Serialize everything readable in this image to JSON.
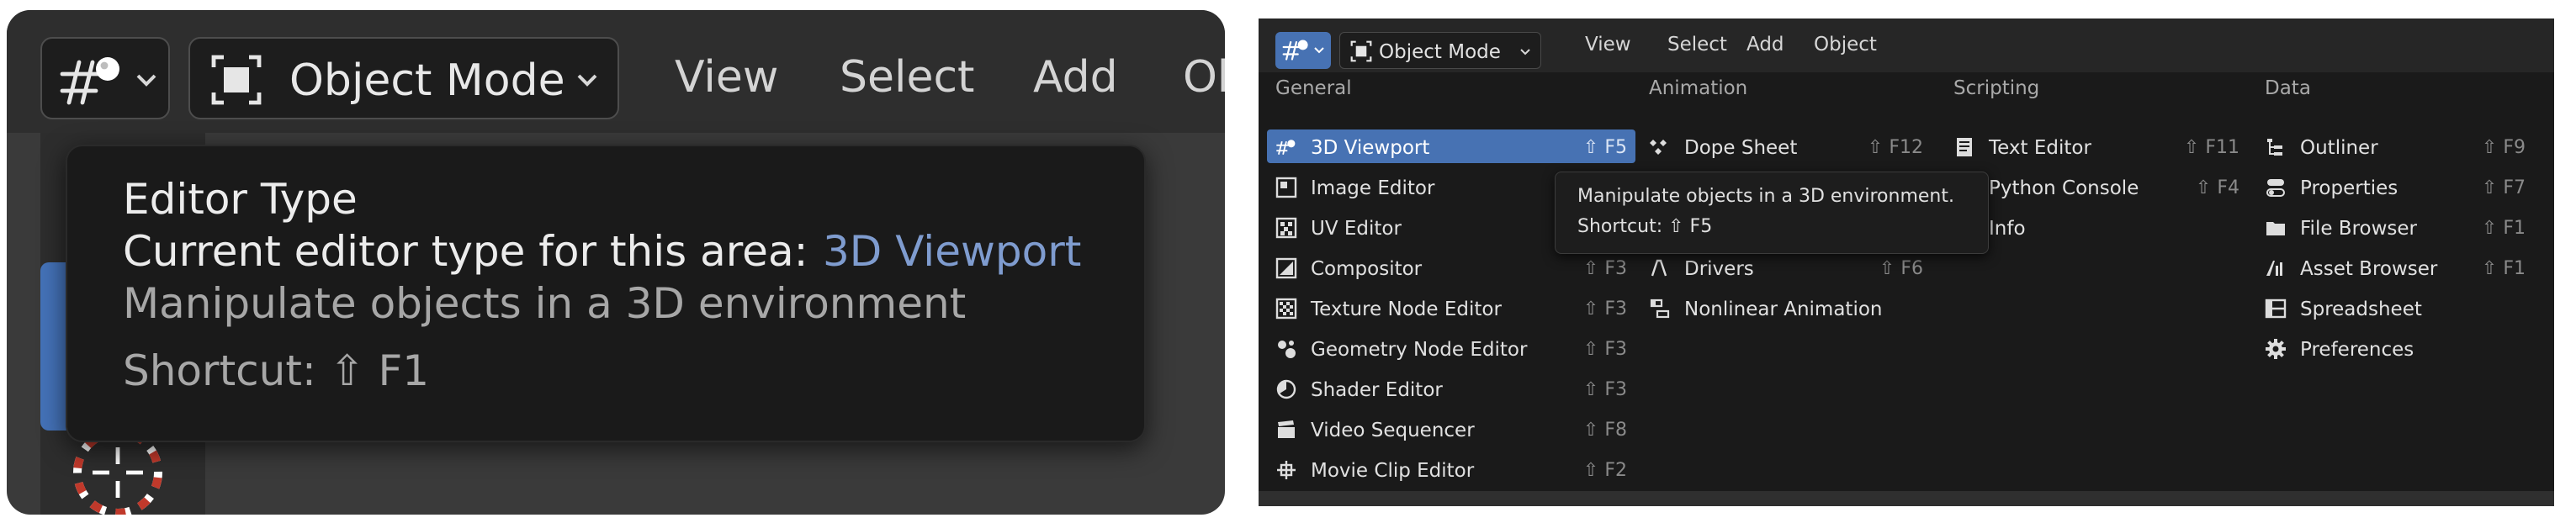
{
  "colors": {
    "accent": "#4772b3",
    "value_blue": "#7f9ccf",
    "menu_bg": "#1a1a1a",
    "header_bg": "#262626"
  },
  "left": {
    "mode_label": "Object Mode",
    "menu": [
      "View",
      "Select",
      "Add",
      "Obje"
    ],
    "tooltip": {
      "title": "Editor Type",
      "current_label": "Current editor type for this area:",
      "current_value": "3D Viewport",
      "description": "Manipulate objects in a 3D environment",
      "shortcut": "Shortcut: ⇧ F1"
    }
  },
  "right": {
    "mode_label": "Object Mode",
    "menu": [
      "View",
      "Select",
      "Add",
      "Object"
    ],
    "categories": {
      "general": {
        "title": "General",
        "items": [
          {
            "label": "3D Viewport",
            "shortcut": "⇧ F5",
            "icon": "viewport-3d-icon",
            "highlighted": true
          },
          {
            "label": "Image Editor",
            "shortcut": "",
            "icon": "image-editor-icon"
          },
          {
            "label": "UV Editor",
            "shortcut": "",
            "icon": "uv-editor-icon"
          },
          {
            "label": "Compositor",
            "shortcut": "⇧ F3",
            "icon": "compositor-icon"
          },
          {
            "label": "Texture Node Editor",
            "shortcut": "⇧ F3",
            "icon": "texture-node-icon"
          },
          {
            "label": "Geometry Node Editor",
            "shortcut": "⇧ F3",
            "icon": "geometry-node-icon"
          },
          {
            "label": "Shader Editor",
            "shortcut": "⇧ F3",
            "icon": "shader-editor-icon"
          },
          {
            "label": "Video Sequencer",
            "shortcut": "⇧ F8",
            "icon": "video-sequencer-icon"
          },
          {
            "label": "Movie Clip Editor",
            "shortcut": "⇧ F2",
            "icon": "movie-clip-icon"
          }
        ]
      },
      "animation": {
        "title": "Animation",
        "items": [
          {
            "label": "Dope Sheet",
            "shortcut": "⇧ F12",
            "icon": "dope-sheet-icon"
          },
          {
            "label": "Drivers",
            "shortcut": "⇧ F6",
            "icon": "drivers-icon"
          },
          {
            "label": "Nonlinear Animation",
            "shortcut": "",
            "icon": "nla-icon"
          }
        ]
      },
      "scripting": {
        "title": "Scripting",
        "items": [
          {
            "label": "Text Editor",
            "shortcut": "⇧ F11",
            "icon": "text-editor-icon"
          },
          {
            "label": "Python Console",
            "shortcut": "⇧ F4",
            "icon": "python-console-icon"
          },
          {
            "label": "Info",
            "shortcut": "",
            "icon": "info-icon"
          }
        ]
      },
      "data": {
        "title": "Data",
        "items": [
          {
            "label": "Outliner",
            "shortcut": "⇧ F9",
            "icon": "outliner-icon"
          },
          {
            "label": "Properties",
            "shortcut": "⇧ F7",
            "icon": "properties-icon"
          },
          {
            "label": "File Browser",
            "shortcut": "⇧ F1",
            "icon": "file-browser-icon"
          },
          {
            "label": "Asset Browser",
            "shortcut": "⇧ F1",
            "icon": "asset-browser-icon"
          },
          {
            "label": "Spreadsheet",
            "shortcut": "",
            "icon": "spreadsheet-icon"
          },
          {
            "label": "Preferences",
            "shortcut": "",
            "icon": "preferences-icon"
          }
        ]
      }
    },
    "tooltip": {
      "description": "Manipulate objects in a 3D environment.",
      "shortcut": "Shortcut: ⇧ F5"
    }
  }
}
